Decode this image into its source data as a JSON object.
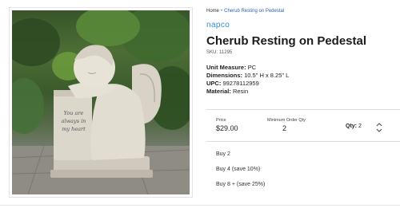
{
  "breadcrumb": {
    "home": "Home",
    "separator": "•",
    "current": "Cherub Resting on Pedestal"
  },
  "product": {
    "brand": "napco",
    "title": "Cherub Resting on Pedestal",
    "sku_label": "SKU:",
    "sku": "11295",
    "specs": [
      {
        "label": "Unit Measure:",
        "value": "PC"
      },
      {
        "label": "Dimensions:",
        "value": "10.5\" H x 8.25\" L"
      },
      {
        "label": "UPC:",
        "value": "99278112959"
      },
      {
        "label": "Material:",
        "value": "Resin"
      }
    ],
    "image": {
      "inscription": [
        "You are",
        "always in",
        "my heart"
      ]
    }
  },
  "buy_box": {
    "price_label": "Price",
    "price": "$29.00",
    "moq_label": "Minimum Order Qty",
    "moq": "2",
    "qty_label": "Qty:",
    "qty": "2"
  },
  "bulk_options": [
    "Buy 2",
    "Buy 4 (save 10%)",
    "Buy 8 + (save 25%)"
  ],
  "colors": {
    "link": "#2a5fbf",
    "brand": "#2f8fd6",
    "text": "#222222"
  }
}
